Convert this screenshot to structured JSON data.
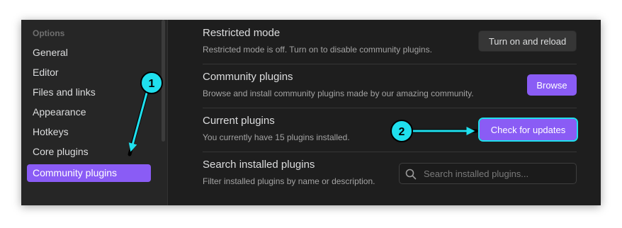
{
  "sidebar": {
    "heading": "Options",
    "items": [
      {
        "label": "General"
      },
      {
        "label": "Editor"
      },
      {
        "label": "Files and links"
      },
      {
        "label": "Appearance"
      },
      {
        "label": "Hotkeys"
      },
      {
        "label": "Core plugins"
      },
      {
        "label": "Community plugins",
        "active": true
      }
    ]
  },
  "settings": {
    "restricted": {
      "name": "Restricted mode",
      "description": "Restricted mode is off. Turn on to disable community plugins.",
      "button": "Turn on and reload"
    },
    "community": {
      "name": "Community plugins",
      "description": "Browse and install community plugins made by our amazing community.",
      "button": "Browse"
    },
    "current": {
      "name": "Current plugins",
      "description": "You currently have 15 plugins installed.",
      "button": "Check for updates"
    },
    "search": {
      "name": "Search installed plugins",
      "description": "Filter installed plugins by name or description.",
      "placeholder": "Search installed plugins...",
      "value": ""
    }
  },
  "annotations": [
    {
      "number": "1"
    },
    {
      "number": "2"
    }
  ],
  "colors": {
    "accent": "#8a5cf5",
    "annotation": "#1fe0ee"
  }
}
